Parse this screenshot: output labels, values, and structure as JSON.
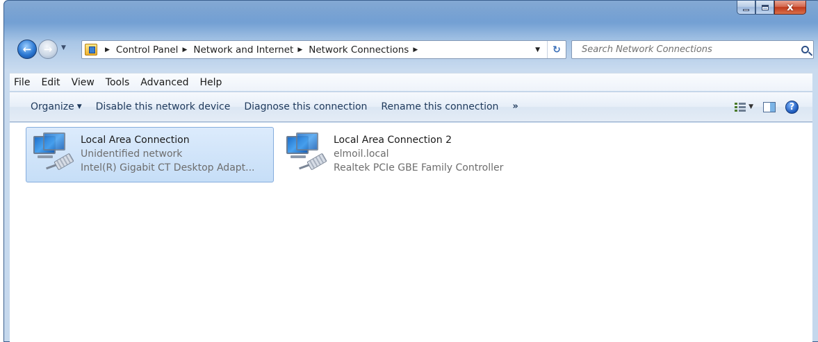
{
  "window": {
    "caption_buttons": {
      "minimize_icon": "minimize-icon",
      "maximize_icon": "maximize-icon",
      "close_icon": "close-icon",
      "close_glyph": "x"
    }
  },
  "nav": {
    "back_glyph": "←",
    "forward_glyph": "→"
  },
  "address_bar": {
    "breadcrumbs": [
      "Control Panel",
      "Network and Internet",
      "Network Connections"
    ],
    "refresh_glyph": "↻"
  },
  "search": {
    "placeholder": "Search Network Connections"
  },
  "menu": {
    "items": [
      "File",
      "Edit",
      "View",
      "Tools",
      "Advanced",
      "Help"
    ]
  },
  "command_bar": {
    "organize": "Organize",
    "disable": "Disable this network device",
    "diagnose": "Diagnose this connection",
    "rename": "Rename this connection",
    "more": "»",
    "help_glyph": "?"
  },
  "connections": [
    {
      "name": "Local Area Connection",
      "status": "Unidentified network",
      "device": "Intel(R) Gigabit CT Desktop Adapt...",
      "selected": true
    },
    {
      "name": "Local Area Connection 2",
      "status": "elmoil.local",
      "device": "Realtek PCIe GBE Family Controller",
      "selected": false
    }
  ],
  "colors": {
    "selection_fill": "#c6def7",
    "selection_border": "#84acdd",
    "command_text": "#1e395b"
  }
}
